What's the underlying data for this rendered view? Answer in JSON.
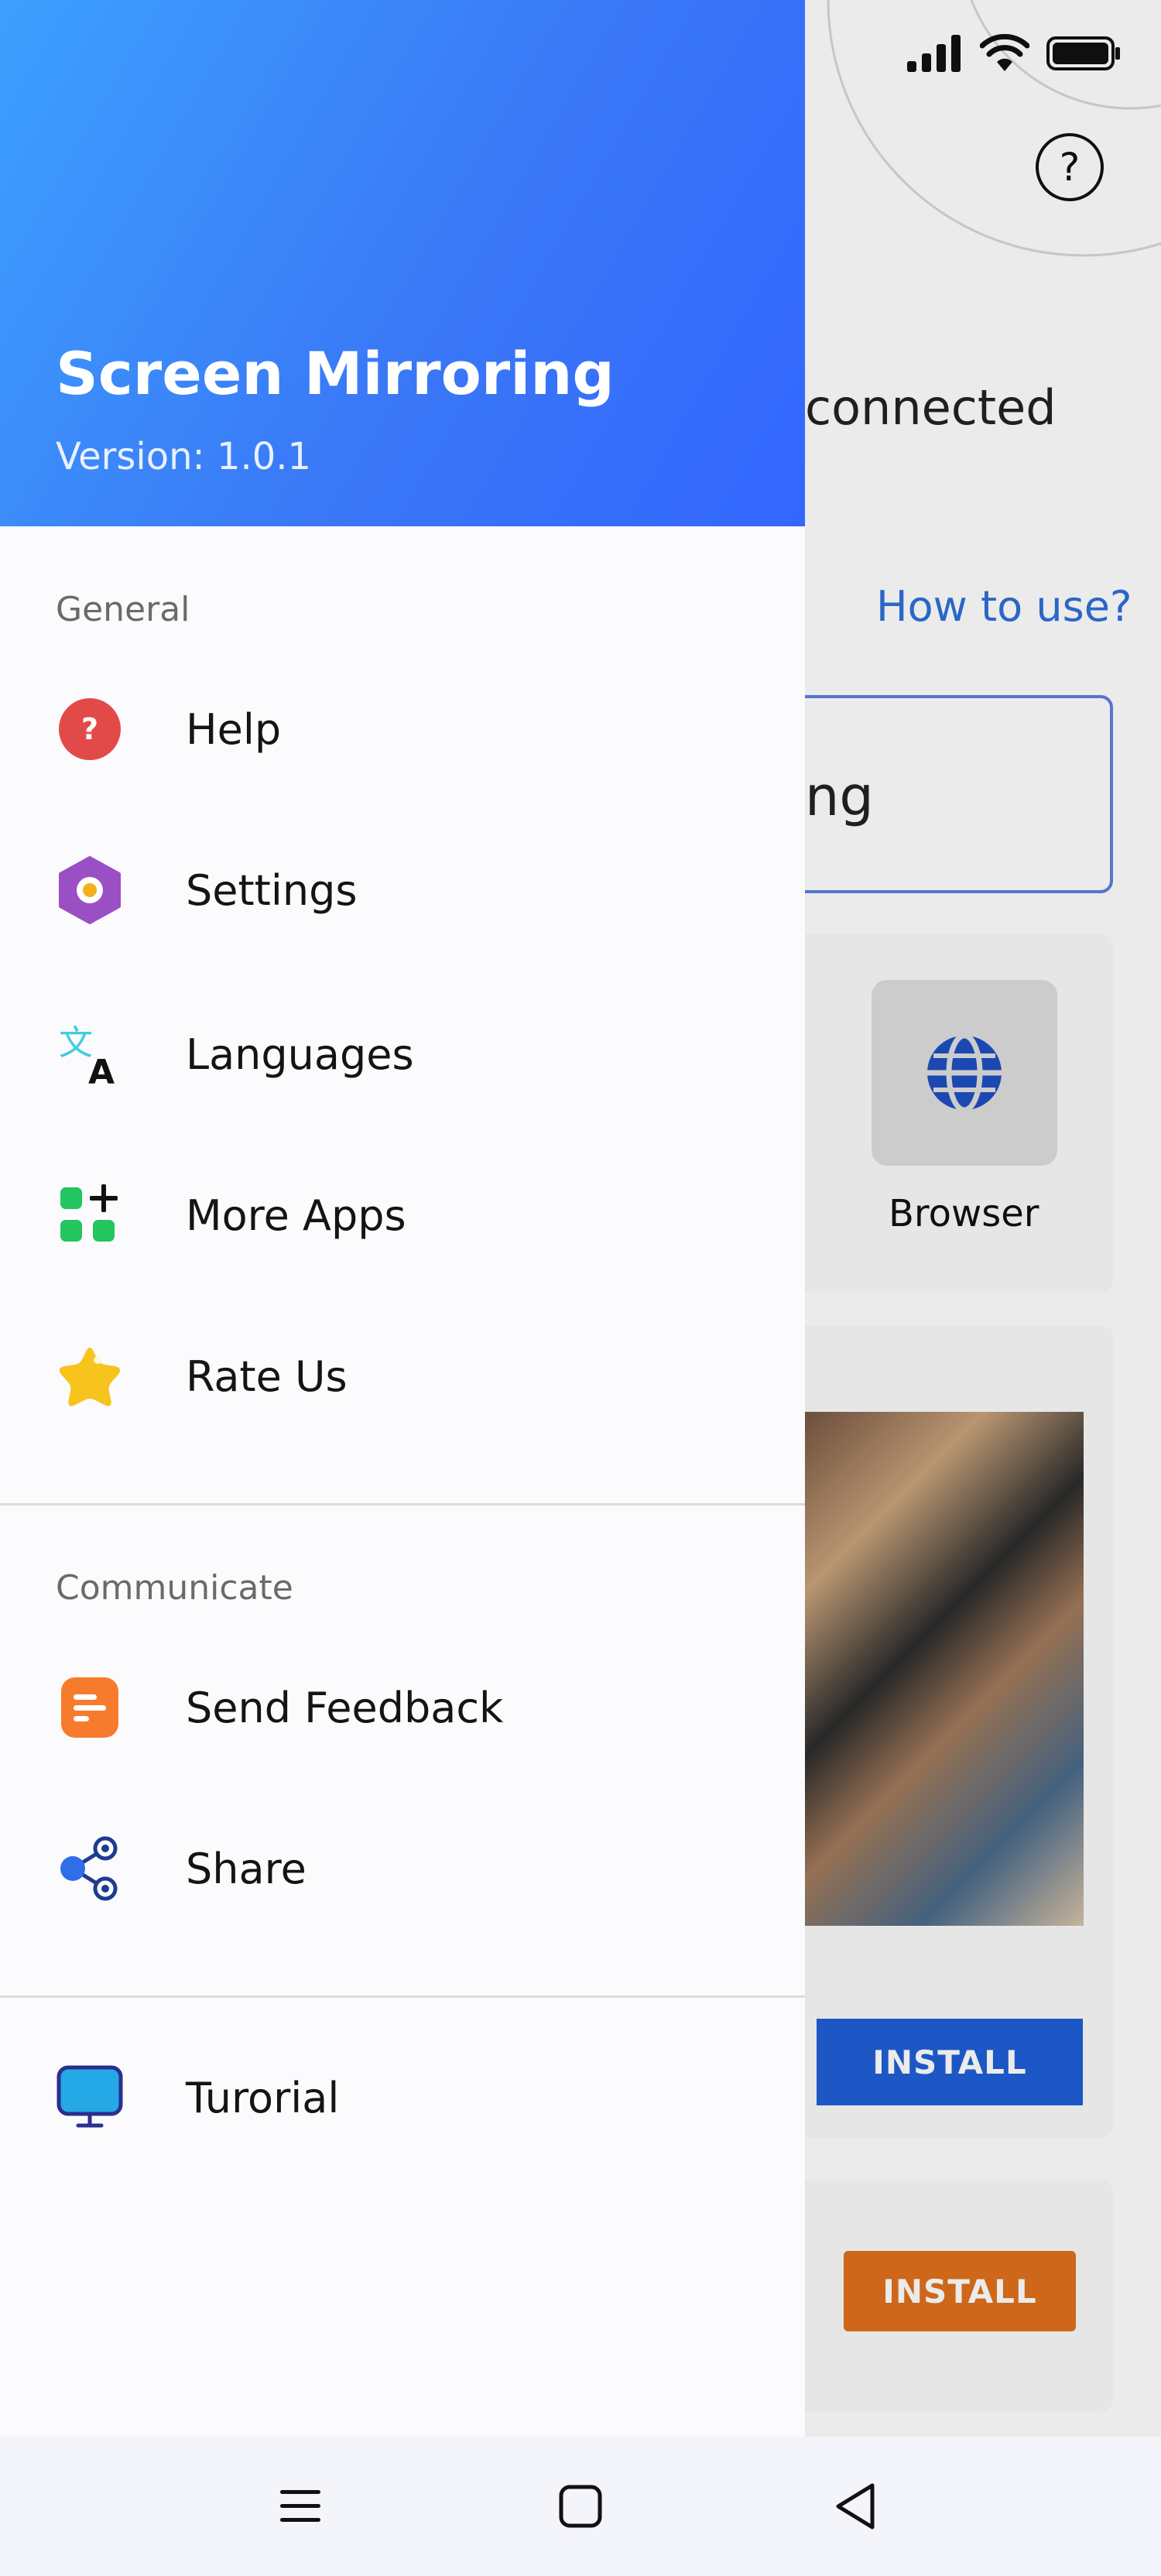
{
  "background": {
    "connection_status": "connected",
    "how_to_use": "How to use?",
    "mirroring_fragment": "ng",
    "browser_label": "Browser",
    "install_blue": "INSTALL",
    "install_orange": "INSTALL",
    "help_icon_glyph": "?"
  },
  "drawer": {
    "title": "Screen Mirroring",
    "version": "Version: 1.0.1",
    "sections": {
      "general": "General",
      "communicate": "Communicate"
    },
    "items": {
      "help": {
        "label": "Help",
        "icon": "help-icon",
        "color": "#e24a4a"
      },
      "settings": {
        "label": "Settings",
        "icon": "settings-hexagon-icon",
        "color": "#9b4fc4"
      },
      "languages": {
        "label": "Languages",
        "icon": "translate-icon",
        "color": "#3fcde0"
      },
      "more_apps": {
        "label": "More Apps",
        "icon": "apps-grid-icon",
        "color": "#22c55e"
      },
      "rate_us": {
        "label": "Rate Us",
        "icon": "star-icon",
        "color": "#f7c31d"
      },
      "send_feedback": {
        "label": "Send Feedback",
        "icon": "feedback-icon",
        "color": "#f77b2c"
      },
      "share": {
        "label": "Share",
        "icon": "share-icon",
        "color": "#2f6ee8"
      },
      "tutorial": {
        "label": "Turorial",
        "icon": "monitor-icon",
        "color": "#24a8e6"
      }
    }
  },
  "nav": {
    "menu": "menu-icon",
    "home": "home-square-icon",
    "back": "back-triangle-icon"
  },
  "colors": {
    "header_gradient_start": "#3da0ff",
    "header_gradient_end": "#3366ff",
    "link_blue": "#2e6fd8"
  }
}
